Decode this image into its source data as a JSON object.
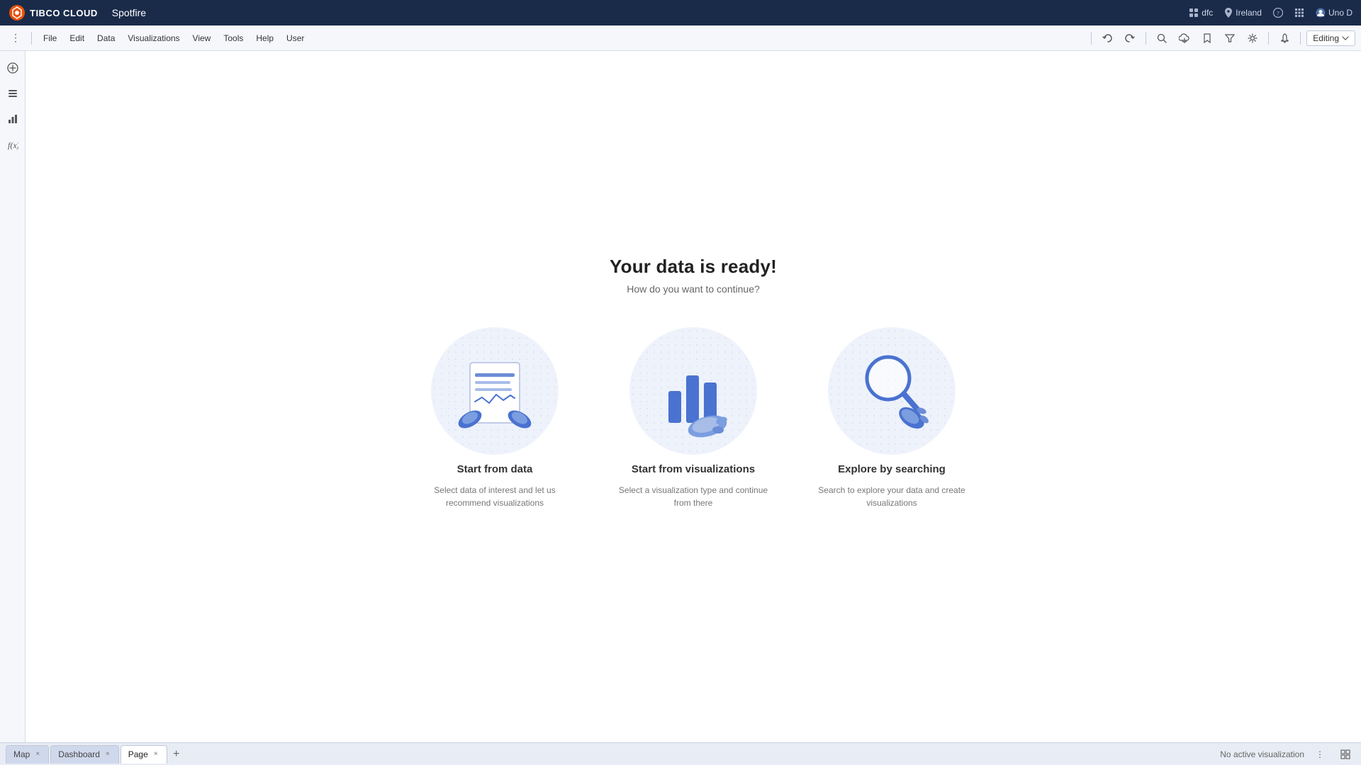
{
  "topbar": {
    "logo_text": "TIBCO CLOUD",
    "app_name": "Spotfire",
    "region_icon": "location-icon",
    "region": "Ireland",
    "user_icon": "user-icon",
    "user_name": "Uno D",
    "dfc_label": "dfc",
    "grid_icon": "grid-icon",
    "help_icon": "help-icon"
  },
  "toolbar": {
    "dots_icon": "dots-icon",
    "file_label": "File",
    "edit_label": "Edit",
    "data_label": "Data",
    "visualizations_label": "Visualizations",
    "view_label": "View",
    "tools_label": "Tools",
    "help_label": "Help",
    "user_label": "User",
    "undo_icon": "undo-icon",
    "redo_icon": "redo-icon",
    "search_icon": "search-icon",
    "cloud_icon": "cloud-icon",
    "bookmark_icon": "bookmark-icon",
    "filter_icon": "filter-icon",
    "settings_icon": "settings-icon",
    "bell_icon": "bell-icon",
    "editing_label": "Editing",
    "chevron_icon": "chevron-down-icon"
  },
  "sidebar": {
    "add_icon": "plus-icon",
    "list_icon": "list-icon",
    "chart_icon": "chart-icon",
    "fx_icon": "formula-icon"
  },
  "main": {
    "title": "Your data is ready!",
    "subtitle": "How do you want to continue?",
    "cards": [
      {
        "id": "start-from-data",
        "title": "Start from data",
        "desc": "Select data of interest and let us recommend visualizations"
      },
      {
        "id": "start-from-visualizations",
        "title": "Start from visualizations",
        "desc": "Select a visualization type and continue from there"
      },
      {
        "id": "explore-by-searching",
        "title": "Explore by searching",
        "desc": "Search to explore your data and create visualizations"
      }
    ]
  },
  "tabbar": {
    "tabs": [
      {
        "label": "Map",
        "active": false
      },
      {
        "label": "Dashboard",
        "active": false
      },
      {
        "label": "Page",
        "active": true
      }
    ],
    "add_tab_label": "+",
    "status_text": "No active visualization"
  }
}
